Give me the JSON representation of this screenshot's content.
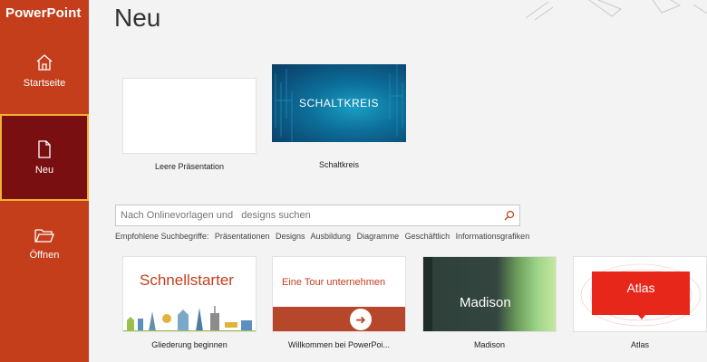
{
  "app": {
    "title": "PowerPoint"
  },
  "sidebar": {
    "items": [
      {
        "label": "Startseite",
        "icon": "home-icon"
      },
      {
        "label": "Neu",
        "icon": "new-document-icon"
      },
      {
        "label": "Öffnen",
        "icon": "folder-open-icon"
      }
    ]
  },
  "main": {
    "title": "Neu",
    "templates_top": [
      {
        "caption": "Leere Präsentation"
      },
      {
        "caption": "Schaltkreis",
        "thumb_text": "SCHALTKREIS"
      }
    ],
    "search": {
      "placeholder": "Nach Onlinevorlagen und   designs suchen"
    },
    "suggestions": {
      "label": "Empfohlene Suchbegriffe:",
      "terms": [
        "Präsentationen",
        "Designs",
        "Ausbildung",
        "Diagramme",
        "Geschäftlich",
        "Informationsgrafiken"
      ]
    },
    "templates_bottom": [
      {
        "caption": "Gliederung beginnen",
        "thumb_text": "Schnellstarter"
      },
      {
        "caption": "Willkommen bei PowerPoi...",
        "thumb_text": "Eine Tour unternehmen"
      },
      {
        "caption": "Madison",
        "thumb_text": "Madison"
      },
      {
        "caption": "Atlas",
        "thumb_text": "Atlas"
      }
    ]
  },
  "colors": {
    "sidebar": "#c43e1c",
    "sidebar_selected": "#7a0f12",
    "selected_border": "#f2b134",
    "accent_red": "#e8271b"
  }
}
